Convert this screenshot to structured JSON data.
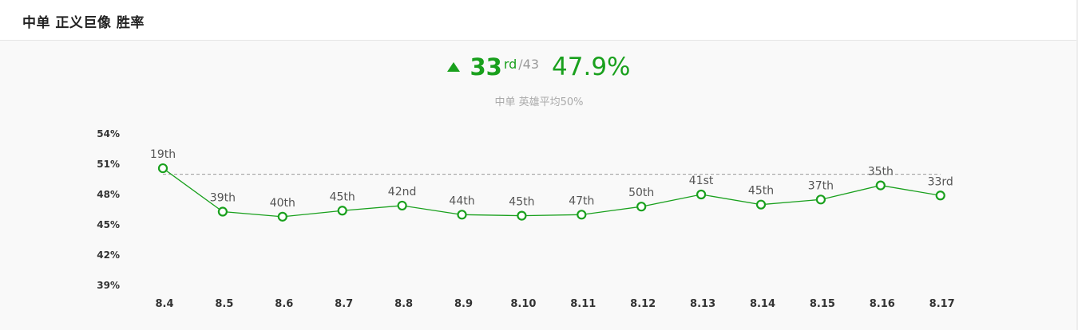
{
  "panel": {
    "title": "中单 正义巨像 胜率"
  },
  "summary": {
    "rank_number": "33",
    "rank_suffix": "rd",
    "rank_total": "/43",
    "win_rate": "47.9%",
    "average_note": "中单 英雄平均50%",
    "trend_icon": "triangle-up-icon"
  },
  "colors": {
    "accent_green": "#19a01d",
    "average_line": "#999999",
    "muted_text": "#aaaaaa"
  },
  "chart_data": {
    "type": "line",
    "title": "",
    "xlabel": "",
    "ylabel": "",
    "categories": [
      "8.4",
      "8.5",
      "8.6",
      "8.7",
      "8.8",
      "8.9",
      "8.10",
      "8.11",
      "8.12",
      "8.13",
      "8.14",
      "8.15",
      "8.16",
      "8.17"
    ],
    "values": [
      50.6,
      46.3,
      45.8,
      46.4,
      46.9,
      46.0,
      45.9,
      46.0,
      46.8,
      48.0,
      47.0,
      47.5,
      48.9,
      47.9
    ],
    "data_labels": [
      "19th",
      "39th",
      "40th",
      "45th",
      "42nd",
      "44th",
      "45th",
      "47th",
      "50th",
      "41st",
      "45th",
      "37th",
      "35th",
      "33rd"
    ],
    "yticks": [
      "54%",
      "51%",
      "48%",
      "45%",
      "42%",
      "39%"
    ],
    "ytick_values": [
      54,
      51,
      48,
      45,
      42,
      39
    ],
    "ylim": [
      39,
      54
    ],
    "reference_line": {
      "value": 50,
      "style": "dashed"
    },
    "grid": false,
    "legend": "none"
  }
}
